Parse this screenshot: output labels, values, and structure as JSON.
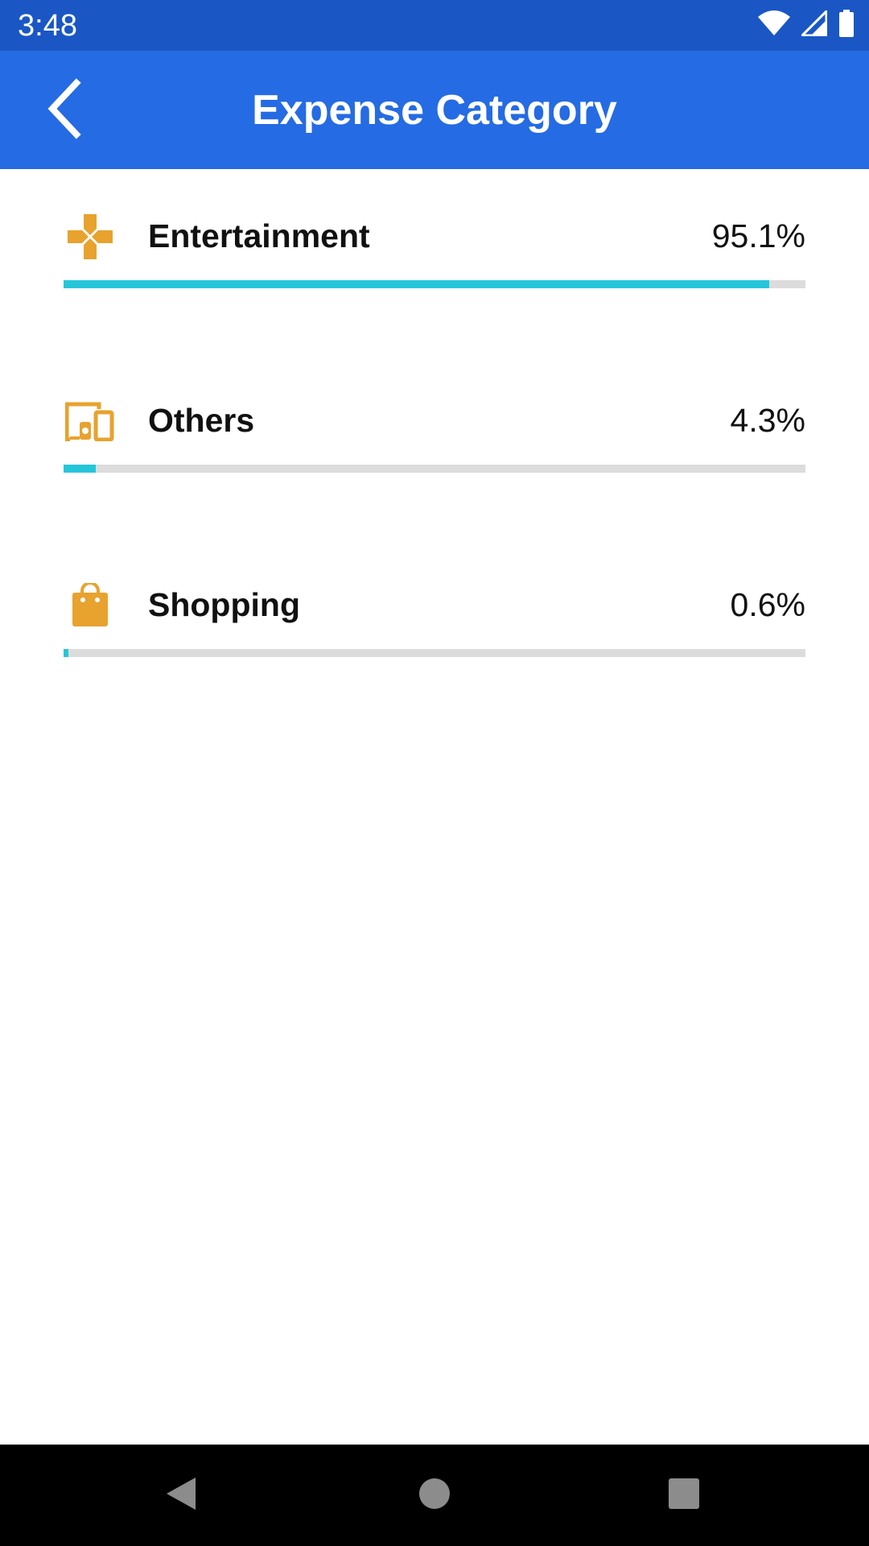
{
  "status_bar": {
    "time": "3:48",
    "icons": [
      "wifi-icon",
      "signal-icon",
      "battery-icon"
    ]
  },
  "app_bar": {
    "title": "Expense Category",
    "back_icon": "chevron-left-icon"
  },
  "categories": [
    {
      "label": "Entertainment",
      "percent_text": "95.1%",
      "fraction": 0.951,
      "icon": "gamepad-icon"
    },
    {
      "label": "Others",
      "percent_text": "4.3%",
      "fraction": 0.043,
      "icon": "devices-icon"
    },
    {
      "label": "Shopping",
      "percent_text": "0.6%",
      "fraction": 0.006,
      "icon": "shopping-bag-icon"
    }
  ],
  "colors": {
    "status_bar": "#1a57c4",
    "app_bar": "#256be3",
    "icon_accent": "#e8a22e",
    "progress_fill": "#26c6da",
    "progress_track": "#dcdcdc"
  },
  "nav_bar": {
    "buttons": [
      "back-triangle-icon",
      "home-circle-icon",
      "recents-square-icon"
    ]
  }
}
